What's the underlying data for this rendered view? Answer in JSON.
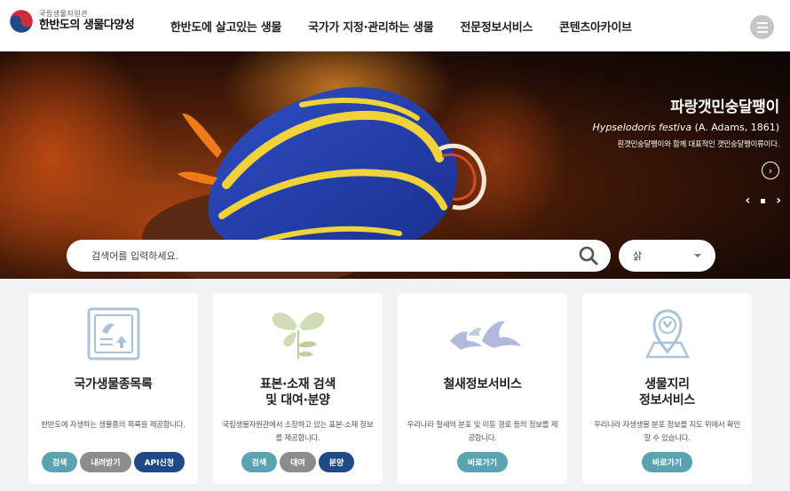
{
  "header": {
    "logo_top": "국립생물자원관",
    "logo_main": "한반도의 생물다양성",
    "nav": [
      "한반도에 살고있는 생물",
      "국가가 지정·관리하는 생물",
      "전문정보서비스",
      "콘텐츠아카이브"
    ]
  },
  "hero": {
    "title": "파랑갯민숭달팽이",
    "sci_name": "Hypselodoris festiva",
    "author": "(A. Adams, 1861)",
    "description": "흰갯민숭달팽이와 함께 대표적인 갯민숭달팽이류이다.",
    "more": "›",
    "prev": "‹",
    "next": "›"
  },
  "search": {
    "placeholder": "검색어를 입력하세요.",
    "select_value": "삵"
  },
  "cards": [
    {
      "title": "국가생물종목록",
      "desc": "한반도에 자생하는 생물종의 목록을 제공합니다.",
      "buttons": [
        "검색",
        "내려받기",
        "API신청"
      ]
    },
    {
      "title_line1": "표본·소재 검색",
      "title_line2": "및 대여·분양",
      "desc": "국립생물자원관에서 소장하고 있는 표본·소재 정보를 제공합니다.",
      "buttons": [
        "검색",
        "대여",
        "분양"
      ]
    },
    {
      "title": "철새정보서비스",
      "desc": "우리나라 철새의 분포 및 이동 경로 등의 정보를 제공합니다.",
      "buttons": [
        "바로가기"
      ]
    },
    {
      "title_line1": "생물지리",
      "title_line2": "정보서비스",
      "desc": "우리나라 자생생물 분포 정보를 지도 위에서 확인할 수 있습니다.",
      "buttons": [
        "바로가기"
      ]
    }
  ],
  "colors": {
    "teal": "#5aa3b1",
    "gray": "#8c8c8c",
    "navy": "#1f4a87",
    "icon": "#a9c3d9"
  }
}
